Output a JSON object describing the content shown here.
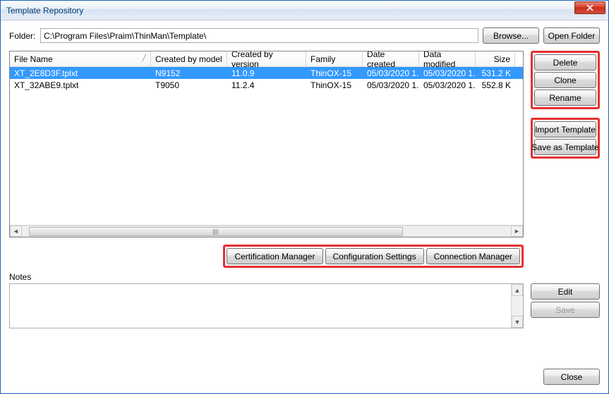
{
  "window": {
    "title": "Template Repository"
  },
  "folder": {
    "label": "Folder:",
    "path": "C:\\Program Files\\Praim\\ThinMan\\Template\\",
    "browse": "Browse...",
    "open": "Open Folder"
  },
  "table": {
    "columns": {
      "file": "File Name",
      "model": "Created by model",
      "version": "Created by version",
      "family": "Family",
      "created": "Date created",
      "modified": "Data modified",
      "size": "Size"
    },
    "rows": [
      {
        "file": "XT_2E8D3F.tplxt",
        "model": "N9152",
        "version": "11.0.9",
        "family": "ThinOX-15",
        "created": "05/03/2020 1...",
        "modified": "05/03/2020 1...",
        "size": "531.2 K",
        "selected": true
      },
      {
        "file": "XT_32ABE9.tplxt",
        "model": "T9050",
        "version": "11.2.4",
        "family": "ThinOX-15",
        "created": "05/03/2020 1...",
        "modified": "05/03/2020 1...",
        "size": "552.8 K",
        "selected": false
      }
    ]
  },
  "side": {
    "delete": "Delete",
    "clone": "Clone",
    "rename": "Rename",
    "import": "Import Template",
    "saveas": "Save as Template"
  },
  "mid": {
    "cert": "Certification Manager",
    "conf": "Configuration Settings",
    "conn": "Connection Manager"
  },
  "notes": {
    "label": "Notes",
    "edit": "Edit",
    "save": "Save"
  },
  "footer": {
    "close": "Close"
  }
}
